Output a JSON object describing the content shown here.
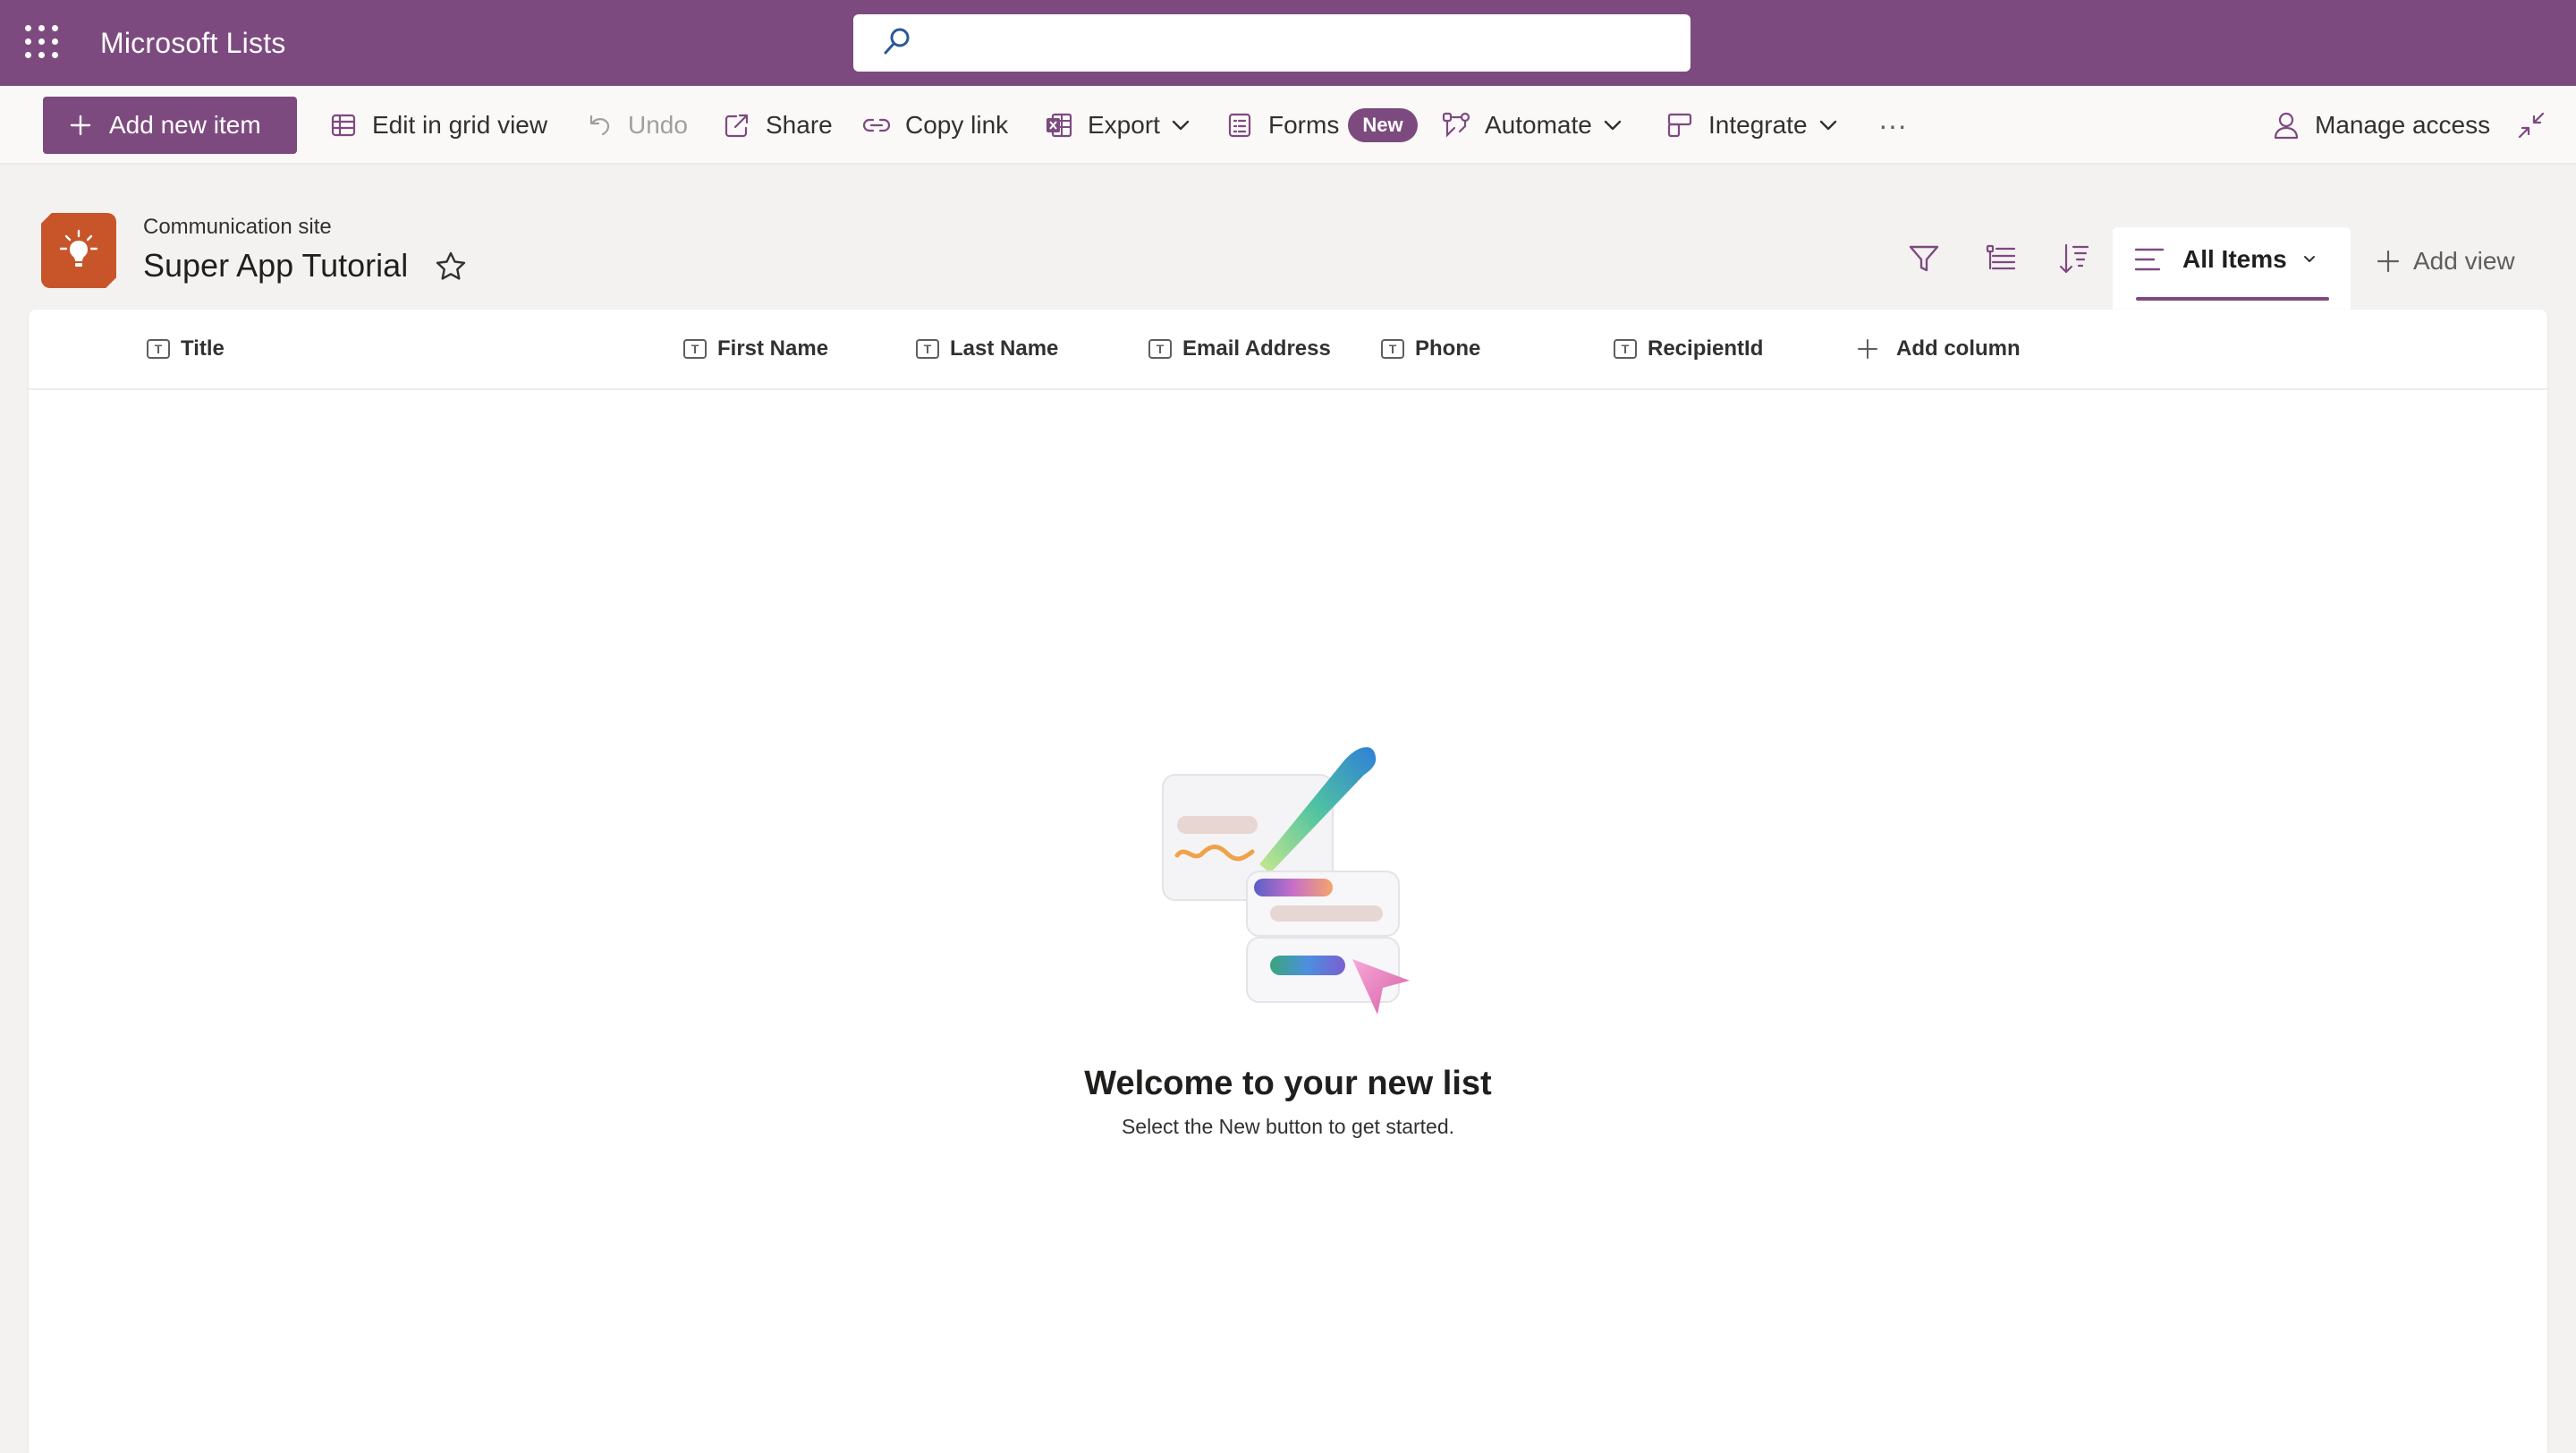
{
  "theme": {
    "brand": "#7d4a7f",
    "site_logo": "#c8552a"
  },
  "suite": {
    "app_title": "Microsoft Lists",
    "search_placeholder": ""
  },
  "commands": {
    "add_new_item": "Add new item",
    "edit_grid": "Edit in grid view",
    "undo": "Undo",
    "share": "Share",
    "copy_link": "Copy link",
    "export": "Export",
    "forms": "Forms",
    "forms_badge": "New",
    "automate": "Automate",
    "integrate": "Integrate",
    "more": "···",
    "manage_access": "Manage access"
  },
  "header": {
    "site_name": "Communication site",
    "list_title": "Super App Tutorial",
    "view_name": "All Items",
    "add_view": "Add view"
  },
  "columns": [
    "Title",
    "First Name",
    "Last Name",
    "Email Address",
    "Phone",
    "RecipientId"
  ],
  "add_column": "Add column",
  "empty_state": {
    "title": "Welcome to your new list",
    "subtitle": "Select the New button to get started."
  },
  "icons": {
    "column_type": "T"
  }
}
